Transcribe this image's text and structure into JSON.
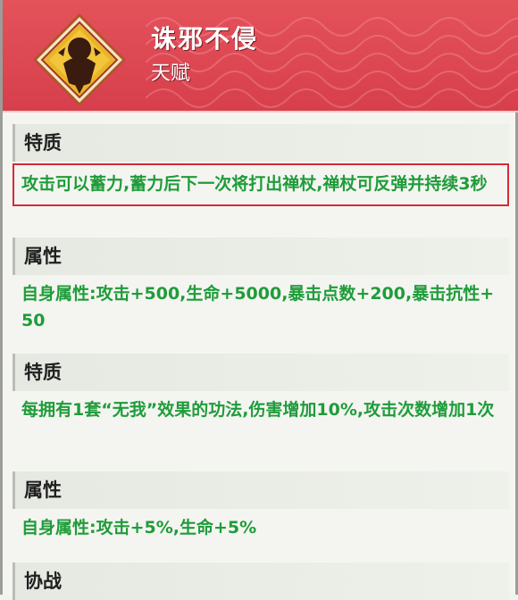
{
  "header": {
    "title": "诛邪不侵",
    "subtitle": "天赋"
  },
  "sections": [
    {
      "heading": "特质",
      "text": "攻击可以蓄力,蓄力后下一次将打出禅杖,禅杖可反弹并持续3秒",
      "highlighted": true
    },
    {
      "heading": "属性",
      "text": "自身属性:攻击+500,生命+5000,暴击点数+200,暴击抗性+50",
      "highlighted": false
    },
    {
      "heading": "特质",
      "text": "每拥有1套“无我”效果的功法,伤害增加10%,攻击次数增加1次",
      "highlighted": false
    },
    {
      "heading": "属性",
      "text": "自身属性:攻击+5%,生命+5%",
      "highlighted": false
    },
    {
      "heading": "协战",
      "text": "",
      "highlighted": false
    }
  ],
  "colors": {
    "header_red": "#dc4752",
    "text_green": "#1f9c3a",
    "highlight_red": "#d62a36",
    "badge_gold": "#e9b428"
  },
  "icons": [
    "talent-emblem-icon"
  ]
}
